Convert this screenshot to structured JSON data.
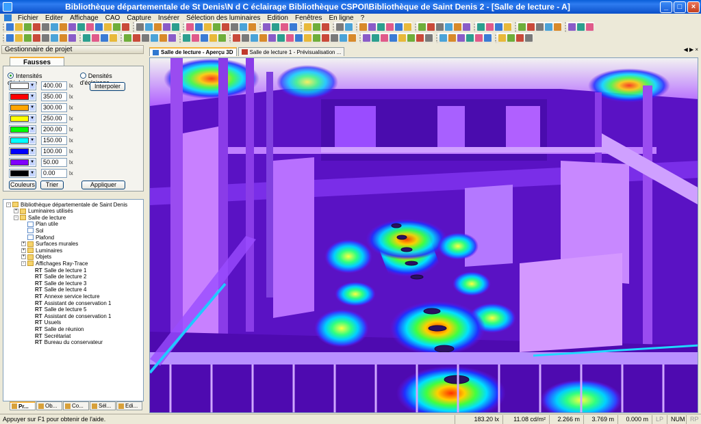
{
  "window": {
    "title": "Bibliothèque départementale de St Denis\\N d C éclairage Bibliothèque CSPOI\\Bibliothèque de Saint Denis 2   -   [Salle de lecture - A]",
    "minimize": "_",
    "maximize": "□",
    "close": "×"
  },
  "menu": [
    "Fichier",
    "Editer",
    "Affichage",
    "CAO",
    "Capture",
    "Insérer",
    "Sélection des luminaires",
    "Edition",
    "Fenêtres",
    "En ligne",
    "?"
  ],
  "left_panel": {
    "header": "Gestionnaire de projet",
    "tab_label": "Fausses couleurs",
    "radio_intensity": "Intensités d'éclairage",
    "radio_density": "Densités d'éclairage",
    "legend": [
      {
        "color": "#ffffff",
        "value": "400.00",
        "unit": "lx"
      },
      {
        "color": "#ff0000",
        "value": "350.00",
        "unit": "lx"
      },
      {
        "color": "#ffa500",
        "value": "300.00",
        "unit": "lx"
      },
      {
        "color": "#ffff00",
        "value": "250.00",
        "unit": "lx"
      },
      {
        "color": "#00ff00",
        "value": "200.00",
        "unit": "lx"
      },
      {
        "color": "#00ffff",
        "value": "150.00",
        "unit": "lx"
      },
      {
        "color": "#0000ff",
        "value": "100.00",
        "unit": "lx"
      },
      {
        "color": "#8000ff",
        "value": "50.00",
        "unit": "lx"
      },
      {
        "color": "#000000",
        "value": "0.00",
        "unit": "lx"
      }
    ],
    "btn_interpolate": "Interpoler",
    "btn_colors": "Couleurs",
    "btn_sort": "Trier",
    "btn_apply": "Appliquer"
  },
  "tree": [
    {
      "label": "Bibliothèque départementale de Saint Denis",
      "level": 0,
      "icon": "folder",
      "exp": "-"
    },
    {
      "label": "Luminaires utilisés",
      "level": 1,
      "icon": "folder",
      "exp": "+"
    },
    {
      "label": "Salle de lecture",
      "level": 1,
      "icon": "folder",
      "exp": "-"
    },
    {
      "label": "Plan utile",
      "level": 2,
      "icon": "doc"
    },
    {
      "label": "Sol",
      "level": 2,
      "icon": "doc"
    },
    {
      "label": "Plafond",
      "level": 2,
      "icon": "doc"
    },
    {
      "label": "Surfaces murales",
      "level": 2,
      "icon": "folder",
      "exp": "+"
    },
    {
      "label": "Luminaires",
      "level": 2,
      "icon": "folder",
      "exp": "+"
    },
    {
      "label": "Objets",
      "level": 2,
      "icon": "folder",
      "exp": "+"
    },
    {
      "label": "Affichages Ray-Trace",
      "level": 2,
      "icon": "folder",
      "exp": "-"
    },
    {
      "label": "Salle  de lecture 1",
      "level": 3,
      "rt": "RT"
    },
    {
      "label": "Salle de lecture 2",
      "level": 3,
      "rt": "RT"
    },
    {
      "label": "Salle de lecture 3",
      "level": 3,
      "rt": "RT"
    },
    {
      "label": "Salle de lecture 4",
      "level": 3,
      "rt": "RT"
    },
    {
      "label": "Annexe service lecture",
      "level": 3,
      "rt": "RT"
    },
    {
      "label": "Assistant de conservation 1",
      "level": 3,
      "rt": "RT"
    },
    {
      "label": "Salle de lecture 5",
      "level": 3,
      "rt": "RT"
    },
    {
      "label": "Assistant de conservation 1",
      "level": 3,
      "rt": "RT"
    },
    {
      "label": "Usuels",
      "level": 3,
      "rt": "RT"
    },
    {
      "label": "Salle de réunion",
      "level": 3,
      "rt": "RT"
    },
    {
      "label": "Secrétariat",
      "level": 3,
      "rt": "RT"
    },
    {
      "label": "Bureau du conservateur",
      "level": 3,
      "rt": "RT"
    }
  ],
  "bottom_tabs": [
    "Pr...",
    "Ob...",
    "Co...",
    "Sél...",
    "Edi..."
  ],
  "doc_tabs": [
    {
      "label": "Salle de lecture - Aperçu 3D",
      "active": true
    },
    {
      "label": "Salle de lecture 1 - Prévisualisation ...",
      "active": false
    }
  ],
  "doc_nav": "◀ ▶ ×",
  "status": {
    "help": "Appuyer sur F1 pour obtenir de l'aide.",
    "lux": "183.20 lx",
    "luminance": "11.08 cd/m²",
    "x": "2.266 m",
    "y": "3.769 m",
    "z": "0.000 m",
    "flag_lp": "LP",
    "num": "NUM",
    "flag_rp": "RP"
  }
}
